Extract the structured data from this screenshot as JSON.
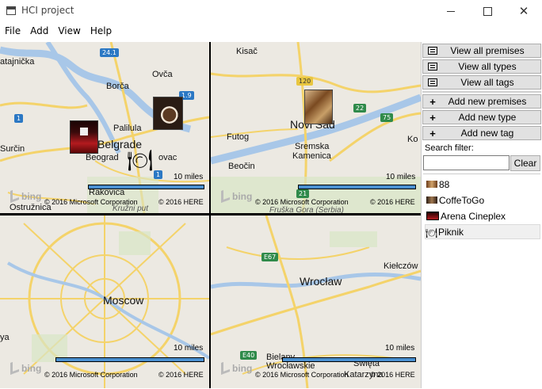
{
  "window": {
    "title": "HCI project"
  },
  "menu": [
    "File",
    "Add",
    "View",
    "Help"
  ],
  "maps": {
    "belgrade": {
      "labels": [
        "atajnička",
        "Borča",
        "Ovča",
        "Palilula",
        "Surčin",
        "Belgrade",
        "Beograd",
        "ovac",
        "Rakovica",
        "Ostružnica",
        "Kružni put"
      ],
      "shields": [
        "24.1",
        "1.9",
        "1",
        "1"
      ],
      "scale": "10 miles",
      "copyright_ms": "© 2016 Microsoft Corporation",
      "copyright_here": "© 2016 HERE"
    },
    "novisad": {
      "labels": [
        "Kisač",
        "Novi Sad",
        "Futog",
        "Sremska",
        "Kamenica",
        "Beočin",
        "Ko",
        "Fruška Gora (Serbia)"
      ],
      "shields": [
        "120",
        "22",
        "75",
        "21"
      ],
      "scale": "10 miles",
      "copyright_ms": "© 2016 Microsoft Corporation",
      "copyright_here": "© 2016 HERE"
    },
    "moscow": {
      "labels": [
        "Moscow",
        "ya"
      ],
      "scale": "10 miles",
      "copyright_ms": "© 2016 Microsoft Corporation",
      "copyright_here": "© 2016 HERE"
    },
    "wroclaw": {
      "labels": [
        "Wrocław",
        "Kiełczów",
        "Bielany",
        "Wrocławskie",
        "Święta",
        "Katarzyna"
      ],
      "shields": [
        "E67",
        "E40"
      ],
      "scale": "10 miles",
      "copyright_ms": "© 2016 Microsoft Corporation",
      "copyright_here": "© 2016 HERE"
    },
    "bing_text": "bing"
  },
  "panel": {
    "view_buttons": [
      "View all premises",
      "View all types",
      "View all tags"
    ],
    "add_buttons": [
      "Add new premises",
      "Add new type",
      "Add new tag"
    ],
    "add_icon": "+",
    "filter_label": "Search filter:",
    "filter_value": "",
    "clear_label": "Clear",
    "items": [
      {
        "label": "88",
        "icon": "restaurant-thumb"
      },
      {
        "label": "CoffeToGo",
        "icon": "coffee-thumb"
      },
      {
        "label": "Arena Cineplex",
        "icon": "cinema-thumb"
      },
      {
        "label": "Piknik",
        "icon": "cutlery-thumb",
        "selected": true
      }
    ]
  },
  "colors": {
    "button_bg": "#e1e1e1",
    "scale_bar": "#4a90d0",
    "road_yellow": "#f4d36a",
    "water": "#a8c7e8",
    "highway_blue": "#2b78c4"
  }
}
